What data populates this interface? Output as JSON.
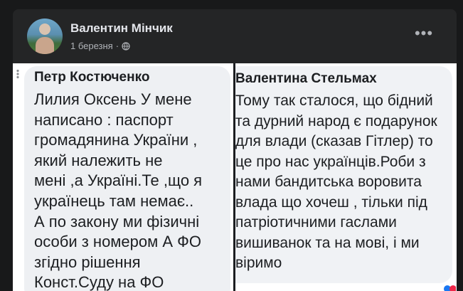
{
  "post": {
    "author_name": "Валентин Мінчик",
    "date": "1 березня",
    "separator": "·",
    "privacy_icon": "globe-icon",
    "more_label": "•••"
  },
  "screenshot_left": {
    "author": "Петр Костюченко",
    "text": "Лилия Оксень У мене\nнаписано : паспорт\nгромадянина України ,\nякий належить не\nмені ,а Україні.Те ,що я\nукраїнець там немає..\nА по закону ми фізичні\nособи з номером А ФО\nзгідно рішення\nКонст.Суду на ФО"
  },
  "screenshot_right": {
    "author": "Валентина Стельмах",
    "text": "Тому так сталося, що бідний\nта дурний народ є подарунок\nдля влади (сказав Гітлер) то\nце про нас українців.Роби з\nнами бандитська воровита\nвлада що хочеш , тільки під\nпатріотичними гаслами\nвишиванок та на мові, і ми\nвіримо"
  },
  "colors": {
    "page_bg": "#18191a",
    "card_bg": "#242526",
    "name_text": "#e4e6eb",
    "meta_text": "#b0b3b8"
  }
}
